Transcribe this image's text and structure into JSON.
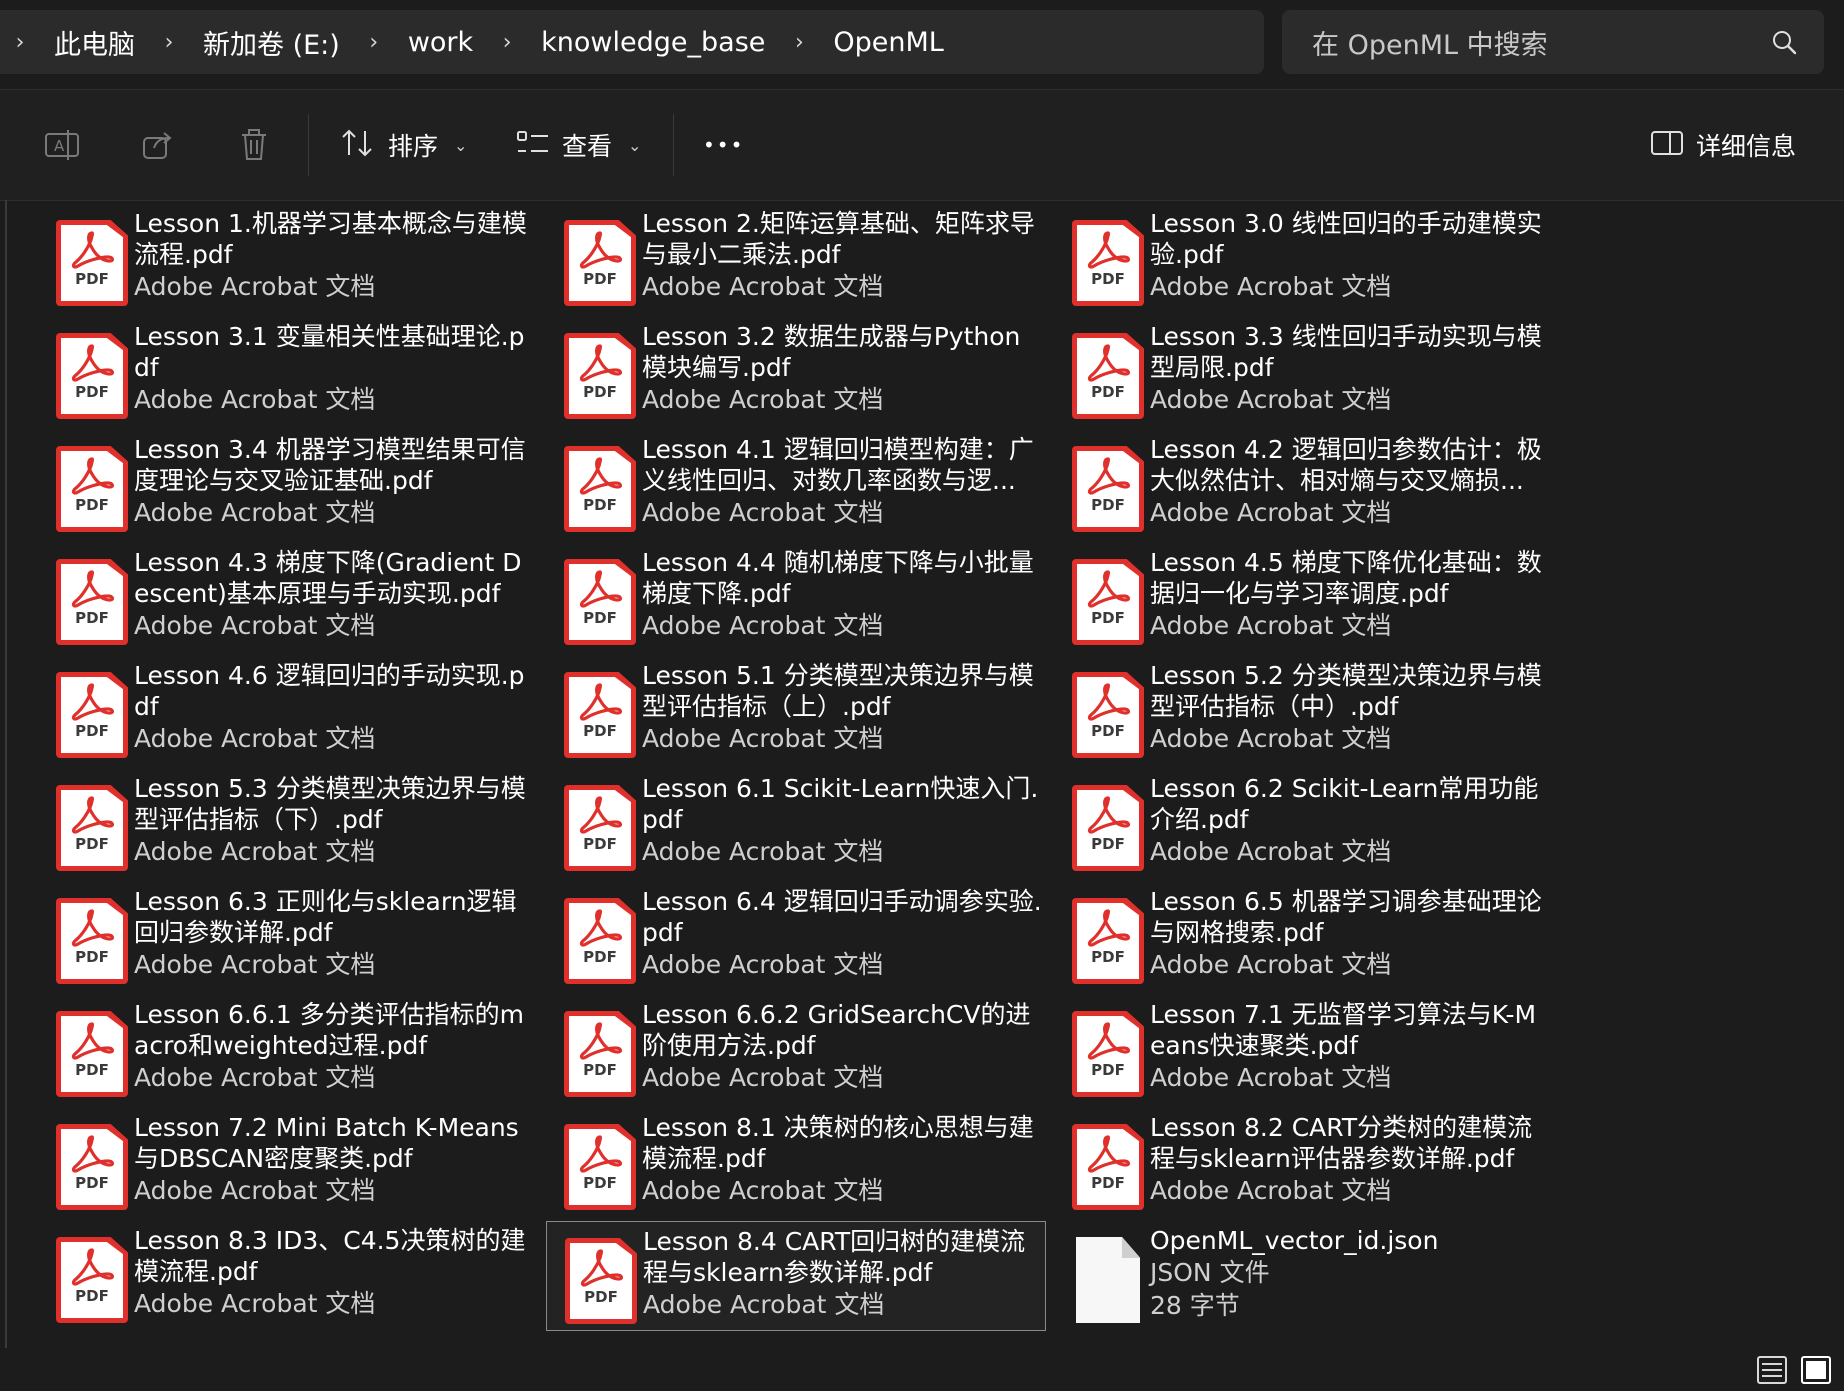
{
  "breadcrumb": [
    "此电脑",
    "新加卷 (E:)",
    "work",
    "knowledge_base",
    "OpenML"
  ],
  "search": {
    "placeholder": "在 OpenML 中搜索"
  },
  "toolbar": {
    "sort_label": "排序",
    "view_label": "查看",
    "more_label": "•••",
    "details_label": "详细信息"
  },
  "files": [
    {
      "name": "Lesson 1.机器学习基本概念与建模流程.pdf",
      "type": "Adobe Acrobat 文档",
      "icon": "pdf-icon"
    },
    {
      "name": "Lesson 2.矩阵运算基础、矩阵求导与最小二乘法.pdf",
      "type": "Adobe Acrobat 文档",
      "icon": "pdf-icon"
    },
    {
      "name": "Lesson 3.0 线性回归的手动建模实验.pdf",
      "type": "Adobe Acrobat 文档",
      "icon": "pdf-icon"
    },
    {
      "name": "Lesson 3.1 变量相关性基础理论.pdf",
      "type": "Adobe Acrobat 文档",
      "icon": "pdf-icon"
    },
    {
      "name": "Lesson 3.2 数据生成器与Python模块编写.pdf",
      "type": "Adobe Acrobat 文档",
      "icon": "pdf-icon"
    },
    {
      "name": "Lesson 3.3 线性回归手动实现与模型局限.pdf",
      "type": "Adobe Acrobat 文档",
      "icon": "pdf-icon"
    },
    {
      "name": "Lesson 3.4 机器学习模型结果可信度理论与交叉验证基础.pdf",
      "type": "Adobe Acrobat 文档",
      "icon": "pdf-icon"
    },
    {
      "name": "Lesson 4.1 逻辑回归模型构建：广义线性回归、对数几率函数与逻...",
      "type": "Adobe Acrobat 文档",
      "icon": "pdf-icon"
    },
    {
      "name": "Lesson 4.2 逻辑回归参数估计：极大似然估计、相对熵与交叉熵损...",
      "type": "Adobe Acrobat 文档",
      "icon": "pdf-icon"
    },
    {
      "name": "Lesson 4.3 梯度下降(Gradient Descent)基本原理与手动实现.pdf",
      "type": "Adobe Acrobat 文档",
      "icon": "pdf-icon"
    },
    {
      "name": "Lesson 4.4 随机梯度下降与小批量梯度下降.pdf",
      "type": "Adobe Acrobat 文档",
      "icon": "pdf-icon"
    },
    {
      "name": "Lesson 4.5 梯度下降优化基础：数据归一化与学习率调度.pdf",
      "type": "Adobe Acrobat 文档",
      "icon": "pdf-icon"
    },
    {
      "name": "Lesson 4.6 逻辑回归的手动实现.pdf",
      "type": "Adobe Acrobat 文档",
      "icon": "pdf-icon"
    },
    {
      "name": "Lesson 5.1 分类模型决策边界与模型评估指标（上）.pdf",
      "type": "Adobe Acrobat 文档",
      "icon": "pdf-icon"
    },
    {
      "name": "Lesson 5.2 分类模型决策边界与模型评估指标（中）.pdf",
      "type": "Adobe Acrobat 文档",
      "icon": "pdf-icon"
    },
    {
      "name": "Lesson 5.3 分类模型决策边界与模型评估指标（下）.pdf",
      "type": "Adobe Acrobat 文档",
      "icon": "pdf-icon"
    },
    {
      "name": "Lesson 6.1 Scikit-Learn快速入门.pdf",
      "type": "Adobe Acrobat 文档",
      "icon": "pdf-icon"
    },
    {
      "name": "Lesson 6.2 Scikit-Learn常用功能介绍.pdf",
      "type": "Adobe Acrobat 文档",
      "icon": "pdf-icon"
    },
    {
      "name": "Lesson 6.3 正则化与sklearn逻辑回归参数详解.pdf",
      "type": "Adobe Acrobat 文档",
      "icon": "pdf-icon"
    },
    {
      "name": "Lesson 6.4 逻辑回归手动调参实验.pdf",
      "type": "Adobe Acrobat 文档",
      "icon": "pdf-icon"
    },
    {
      "name": "Lesson 6.5 机器学习调参基础理论与网格搜索.pdf",
      "type": "Adobe Acrobat 文档",
      "icon": "pdf-icon"
    },
    {
      "name": "Lesson 6.6.1 多分类评估指标的macro和weighted过程.pdf",
      "type": "Adobe Acrobat 文档",
      "icon": "pdf-icon"
    },
    {
      "name": "Lesson 6.6.2 GridSearchCV的进阶使用方法.pdf",
      "type": "Adobe Acrobat 文档",
      "icon": "pdf-icon"
    },
    {
      "name": "Lesson 7.1 无监督学习算法与K-Means快速聚类.pdf",
      "type": "Adobe Acrobat 文档",
      "icon": "pdf-icon"
    },
    {
      "name": "Lesson 7.2 Mini Batch K-Means与DBSCAN密度聚类.pdf",
      "type": "Adobe Acrobat 文档",
      "icon": "pdf-icon"
    },
    {
      "name": "Lesson 8.1 决策树的核心思想与建模流程.pdf",
      "type": "Adobe Acrobat 文档",
      "icon": "pdf-icon"
    },
    {
      "name": "Lesson 8.2 CART分类树的建模流程与sklearn评估器参数详解.pdf",
      "type": "Adobe Acrobat 文档",
      "icon": "pdf-icon"
    },
    {
      "name": "Lesson 8.3 ID3、C4.5决策树的建模流程.pdf",
      "type": "Adobe Acrobat 文档",
      "icon": "pdf-icon"
    },
    {
      "name": "Lesson 8.4 CART回归树的建模流程与sklearn参数详解.pdf",
      "type": "Adobe Acrobat 文档",
      "icon": "pdf-icon",
      "selected": true
    },
    {
      "name": "OpenML_vector_id.json",
      "type": "JSON 文件",
      "size": "28 字节",
      "icon": "file-icon"
    }
  ],
  "colors": {
    "background": "#1c1c1c",
    "pdf_red": "#e0302c",
    "text": "#ffffff",
    "subtext": "#cfcfcf"
  }
}
